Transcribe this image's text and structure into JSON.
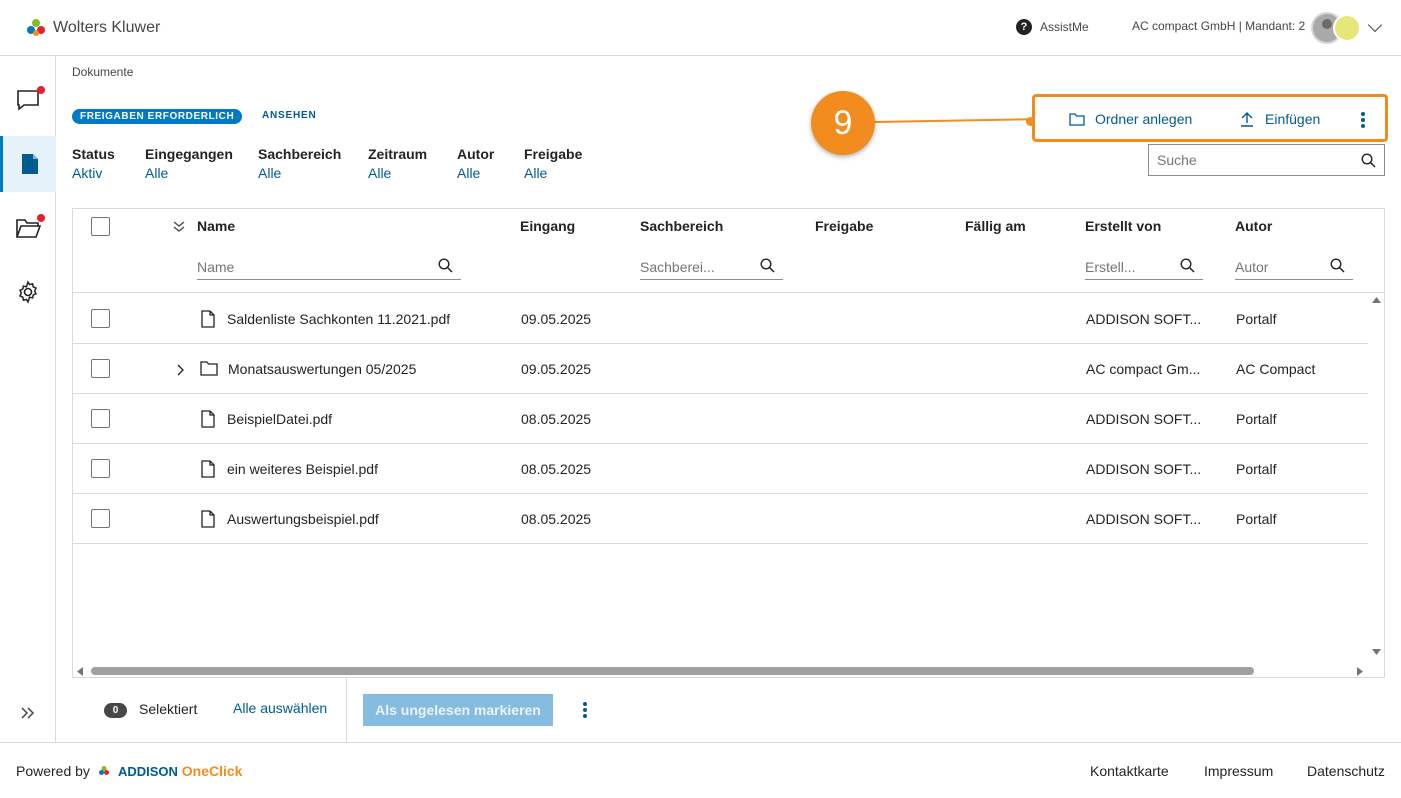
{
  "header": {
    "brand": "Wolters Kluwer",
    "assist": "AssistMe",
    "mandant": "AC compact GmbH | Mandant: 2"
  },
  "breadcrumb": "Dokumente",
  "badge": "FREIGABEN ERFORDERLICH",
  "ansehen": "ANSEHEN",
  "filters": [
    {
      "label": "Status",
      "value": "Aktiv"
    },
    {
      "label": "Eingegangen",
      "value": "Alle"
    },
    {
      "label": "Sachbereich",
      "value": "Alle"
    },
    {
      "label": "Zeitraum",
      "value": "Alle"
    },
    {
      "label": "Autor",
      "value": "Alle"
    },
    {
      "label": "Freigabe",
      "value": "Alle"
    }
  ],
  "step_marker": "9",
  "actions": {
    "new_folder": "Ordner anlegen",
    "insert": "Einfügen"
  },
  "search": {
    "placeholder": "Suche"
  },
  "columns": {
    "name": "Name",
    "eingang": "Eingang",
    "sachbereich": "Sachbereich",
    "freigabe": "Freigabe",
    "faellig": "Fällig am",
    "erstellt": "Erstellt von",
    "autor": "Autor"
  },
  "column_filters": {
    "name": "Name",
    "sachbereich": "Sachberei...",
    "erstellt": "Erstell...",
    "autor": "Autor"
  },
  "rows": [
    {
      "name": "Saldenliste Sachkonten 11.2021.pdf",
      "eingang": "09.05.2025",
      "erstellt": "ADDISON SOFT...",
      "autor": "Portalf"
    },
    {
      "name": "Monatsauswertungen 05/2025",
      "eingang": "09.05.2025",
      "erstellt": "AC compact Gm...",
      "autor": "AC Compact"
    },
    {
      "name": "BeispielDatei.pdf",
      "eingang": "08.05.2025",
      "erstellt": "ADDISON SOFT...",
      "autor": "Portalf"
    },
    {
      "name": "ein weiteres Beispiel.pdf",
      "eingang": "08.05.2025",
      "erstellt": "ADDISON SOFT...",
      "autor": "Portalf"
    },
    {
      "name": "Auswertungsbeispiel.pdf",
      "eingang": "08.05.2025",
      "erstellt": "ADDISON SOFT...",
      "autor": "Portalf"
    }
  ],
  "bottom": {
    "count": "0",
    "selected": "Selektiert",
    "select_all": "Alle auswählen",
    "mark_unread": "Als ungelesen markieren"
  },
  "footer": {
    "powered_by": "Powered by",
    "addison": "ADDISON",
    "oneclick": "OneClick",
    "links": [
      "Kontaktkarte",
      "Impressum",
      "Datenschutz"
    ]
  }
}
